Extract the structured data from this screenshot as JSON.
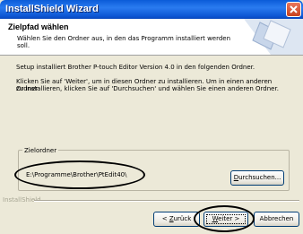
{
  "window": {
    "title": "InstallShield Wizard"
  },
  "header": {
    "title": "Zielpfad wählen",
    "subtitle_line1": "Wählen Sie den Ordner aus, in den das Programm installiert werden",
    "subtitle_line2": "soll."
  },
  "body": {
    "line1": "Setup installiert Brother P-touch Editor Version 4.0 in den folgenden Ordner.",
    "line2": "Klicken Sie auf 'Weiter', um in diesen Ordner zu installieren. Um in einen anderen Ordner",
    "line3": "zu installieren, klicken Sie auf 'Durchsuchen' und wählen Sie einen anderen Ordner."
  },
  "dest": {
    "group_label": "Zielordner",
    "path": "E:\\Programme\\Brother\\PtEdit40\\",
    "browse_pre": "D",
    "browse_rest": "urchsuchen..."
  },
  "footer": {
    "brand": "InstallShield",
    "back_pre": "< ",
    "back_u": "Z",
    "back_rest": "urück",
    "next_u": "W",
    "next_rest": "eiter >",
    "cancel": "Abbrechen"
  },
  "colors": {
    "titlebar": "#0A5BD8",
    "face": "#ECE9D8",
    "annotation": "#000000"
  }
}
